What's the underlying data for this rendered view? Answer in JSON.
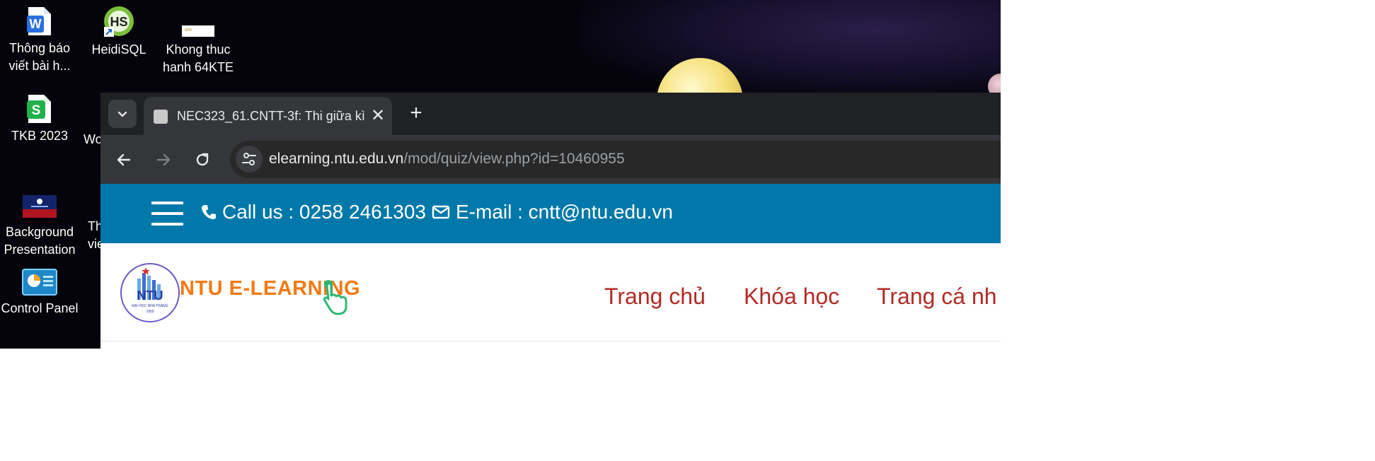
{
  "desktop": {
    "icons": [
      {
        "name": "word-doc",
        "label_lines": [
          "Thông báo",
          "viết bài h..."
        ]
      },
      {
        "name": "heidisql",
        "label_lines": [
          "HeidiSQL"
        ]
      },
      {
        "name": "khong-thuc-hanh",
        "label_lines": [
          "Khong thuc",
          "hanh 64KTE"
        ]
      },
      {
        "name": "tkb-2023",
        "label_lines": [
          "TKB 2023"
        ]
      },
      {
        "name": "background-presentation",
        "label_lines": [
          "Background",
          "Presentation"
        ]
      },
      {
        "name": "control-panel",
        "label_lines": [
          "Control Panel"
        ]
      }
    ],
    "partial_labels": {
      "wo": "Wo",
      "th": "Th",
      "vi": "vie"
    },
    "heidisql_badge": "HS"
  },
  "browser": {
    "tab": {
      "title": "NEC323_61.CNTT-3f: Thi giữa kì",
      "close_symbol": "✕"
    },
    "new_tab_symbol": "+",
    "url_host": "elearning.ntu.edu.vn",
    "url_path": "/mod/quiz/view.php?id=10460955",
    "icons": {
      "tab_search": "chevron-down-icon",
      "back": "arrow-left-icon",
      "forward": "arrow-right-icon",
      "reload": "reload-icon",
      "site_info": "tune-icon"
    }
  },
  "site": {
    "colors": {
      "topbar": "#0078a9",
      "menu": "#b22a24",
      "logo_orange": "#f27a14"
    },
    "topbar": {
      "call_label": "Call us : 0258 2461303",
      "email_label": "E-mail : cntt@ntu.edu.vn"
    },
    "logo": {
      "text": "NTU E-LEARNING",
      "emblem_text": "NTU",
      "emblem_sub": "ĐẠI HỌC NHA TRANG",
      "emblem_year": "1959"
    },
    "menu": [
      "Trang chủ",
      "Khóa học",
      "Trang cá nh"
    ]
  }
}
